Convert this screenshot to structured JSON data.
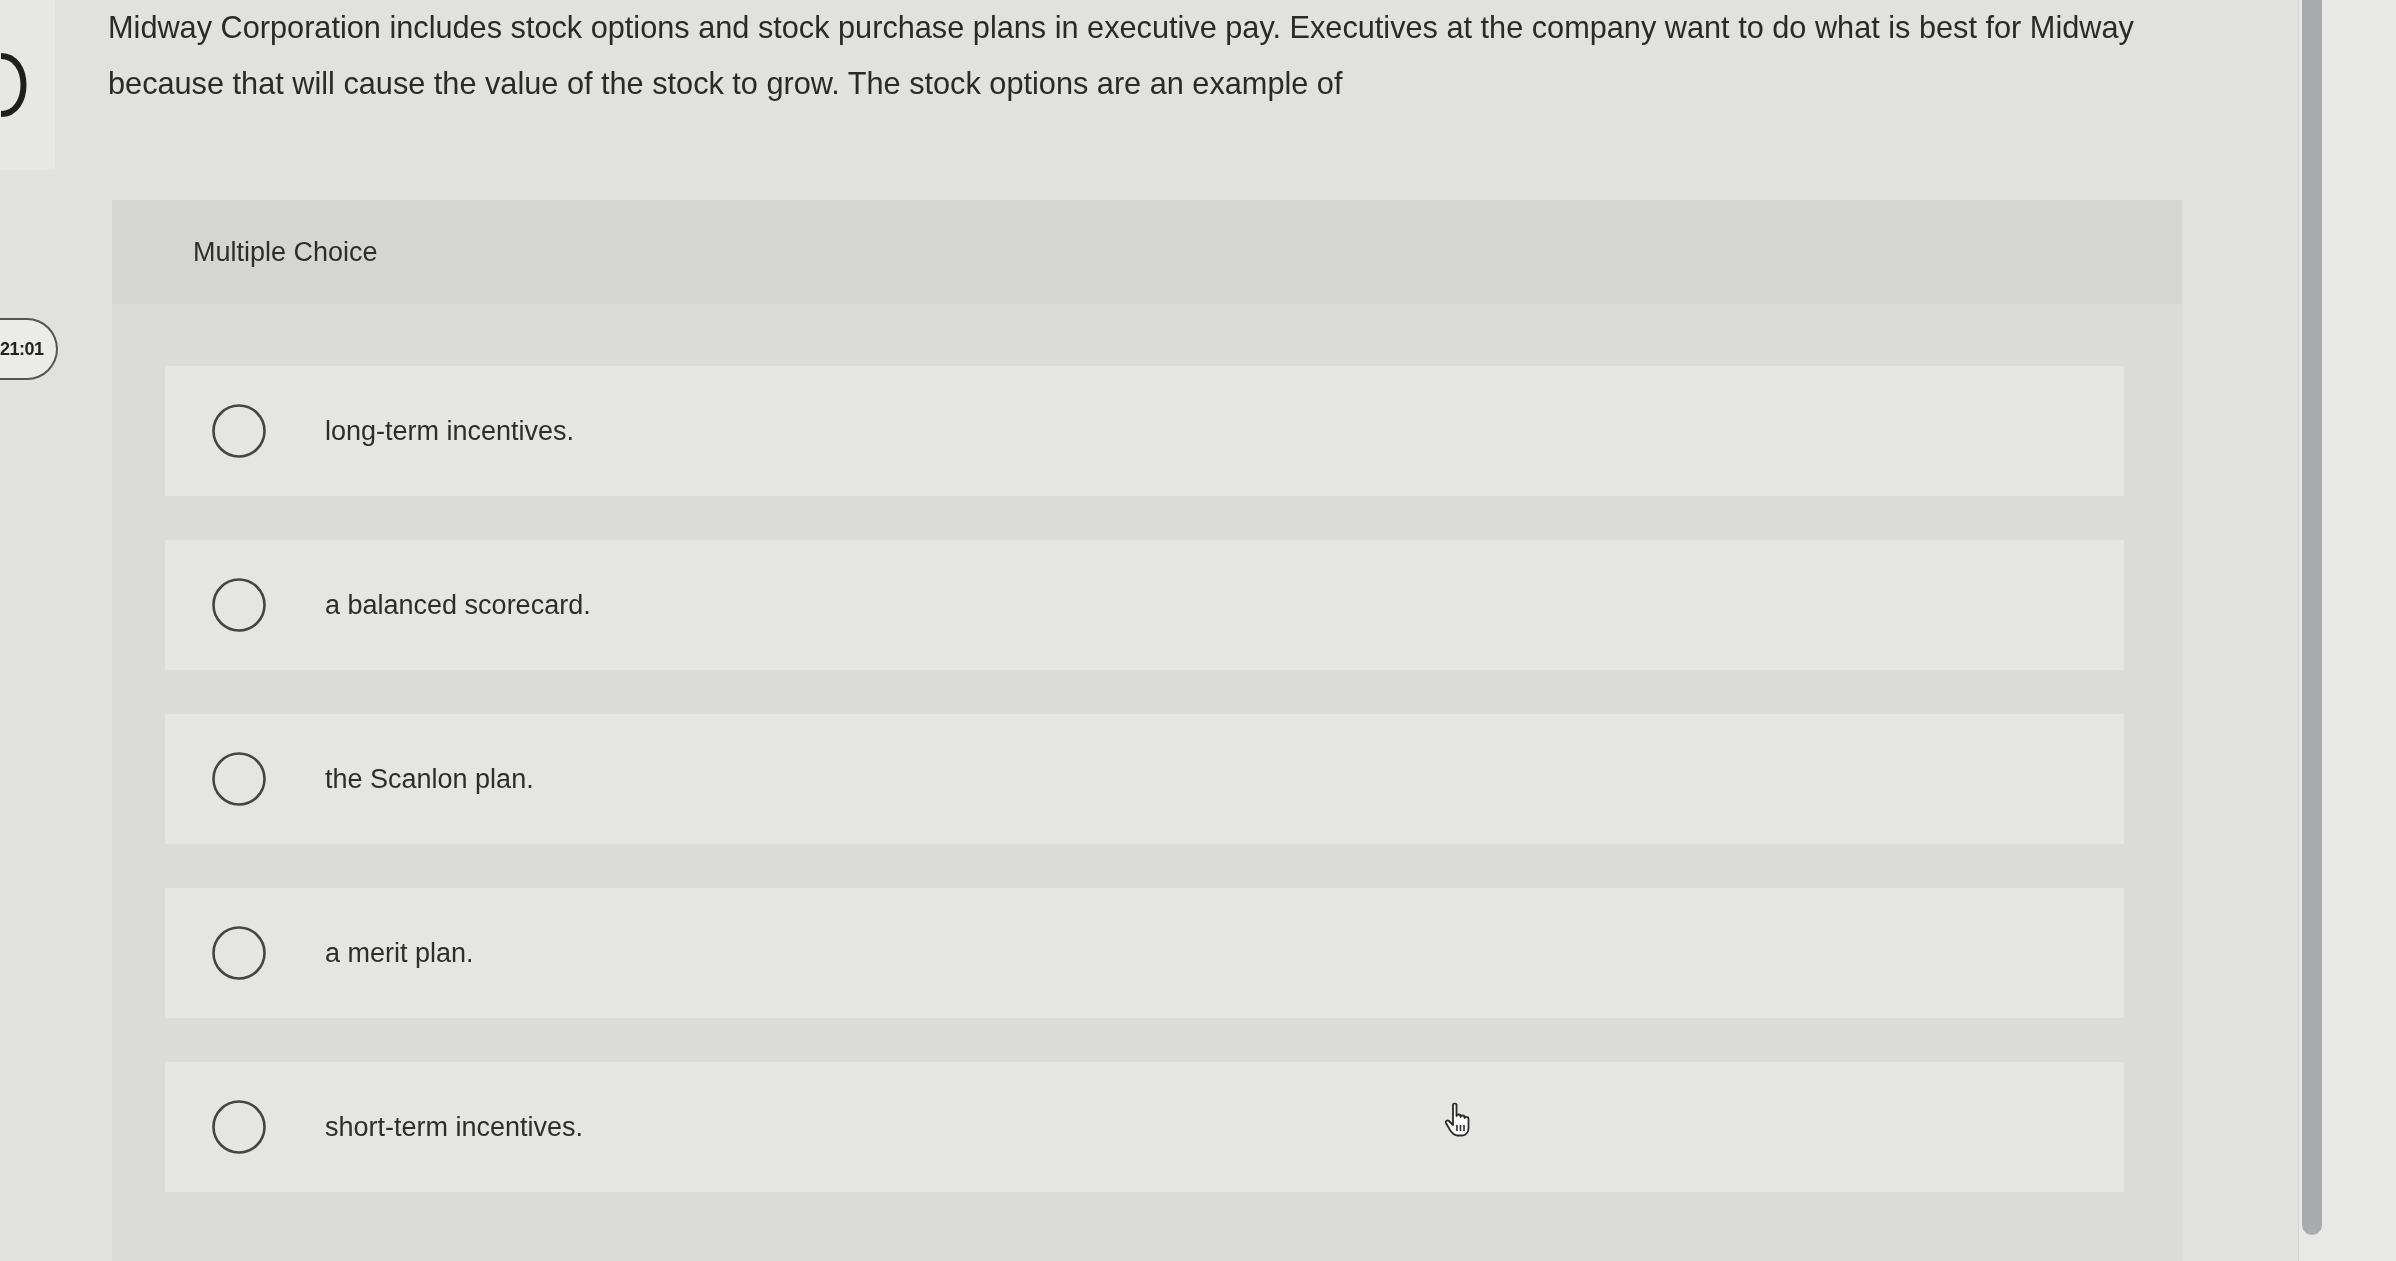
{
  "sidebar": {
    "timer": "21:01"
  },
  "question": {
    "text": "Midway Corporation includes stock options and stock purchase plans in executive pay. Executives at the company want to do what is best for Midway because that will cause the value of the stock to grow. The stock options are an example of"
  },
  "answer_panel": {
    "heading": "Multiple Choice",
    "options": [
      {
        "label": "long-term incentives.",
        "selected": false
      },
      {
        "label": "a balanced scorecard.",
        "selected": false
      },
      {
        "label": "the Scanlon plan.",
        "selected": false
      },
      {
        "label": "a merit plan.",
        "selected": false
      },
      {
        "label": "short-term incentives.",
        "selected": false
      }
    ]
  }
}
